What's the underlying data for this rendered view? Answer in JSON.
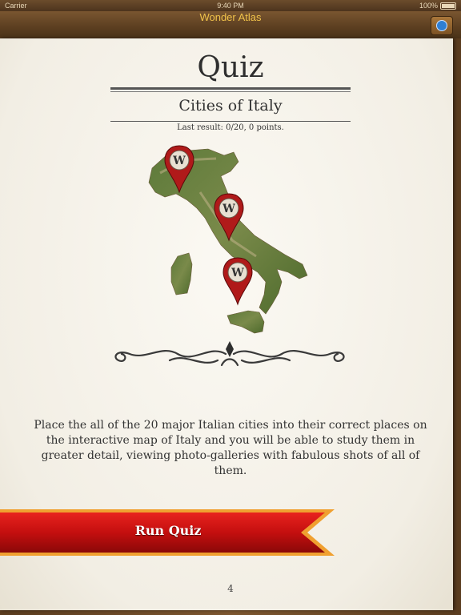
{
  "status_bar": {
    "carrier": "Carrier",
    "time": "9:40 PM",
    "battery": "100%"
  },
  "nav": {
    "title": "Wonder Atlas",
    "info_icon": "info-icon"
  },
  "page": {
    "title": "Quiz",
    "subtitle": "Cities of Italy",
    "last_result": "Last result: 0/20, 0 points.",
    "pin_letter": "W",
    "description": "Place the all of the 20 major Italian cities into their correct places on the interactive map of Italy and you will be able to study them in greater detail, viewing photo-galleries with fabulous shots of all of them.",
    "button_label": "Run Quiz",
    "page_number": "4"
  },
  "colors": {
    "nav_title": "#f0c24a",
    "ribbon": "#c40f0f",
    "ribbon_border": "#f0a030",
    "pin": "#b01a1a"
  }
}
